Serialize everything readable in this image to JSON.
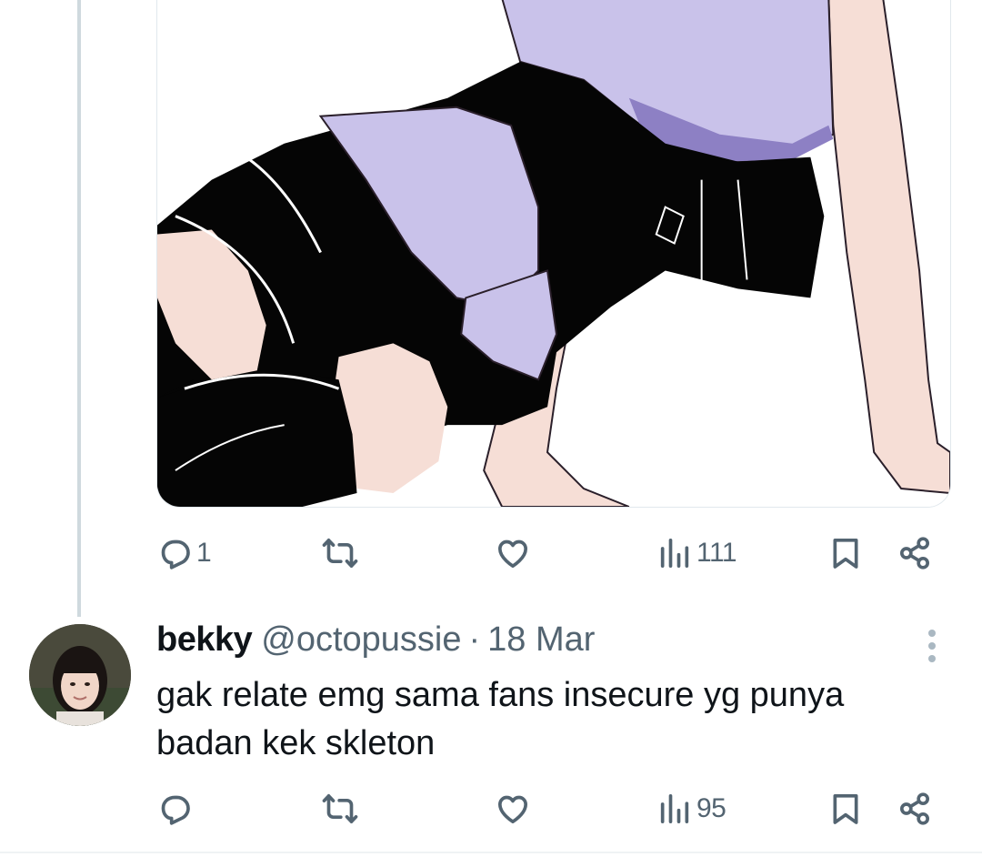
{
  "first_tweet": {
    "media_icon": "anime-artwork-image",
    "actions": {
      "reply_count": "1",
      "retweet_count": "",
      "like_count": "",
      "views_count": "111"
    }
  },
  "reply_tweet": {
    "display_name": "bekky",
    "handle": "@octopussie",
    "separator": "·",
    "date": "18 Mar",
    "text": "gak relate emg sama fans insecure yg punya badan kek skleton",
    "actions": {
      "reply_count": "",
      "retweet_count": "",
      "like_count": "",
      "views_count": "95"
    }
  },
  "icons": {
    "reply": "reply-icon",
    "retweet": "retweet-icon",
    "like": "heart-icon",
    "views": "views-icon",
    "bookmark": "bookmark-icon",
    "share": "share-icon",
    "more": "more-icon"
  },
  "colors": {
    "text_primary": "#0f1419",
    "text_secondary": "#536471",
    "thread_line": "#cfd9de"
  }
}
